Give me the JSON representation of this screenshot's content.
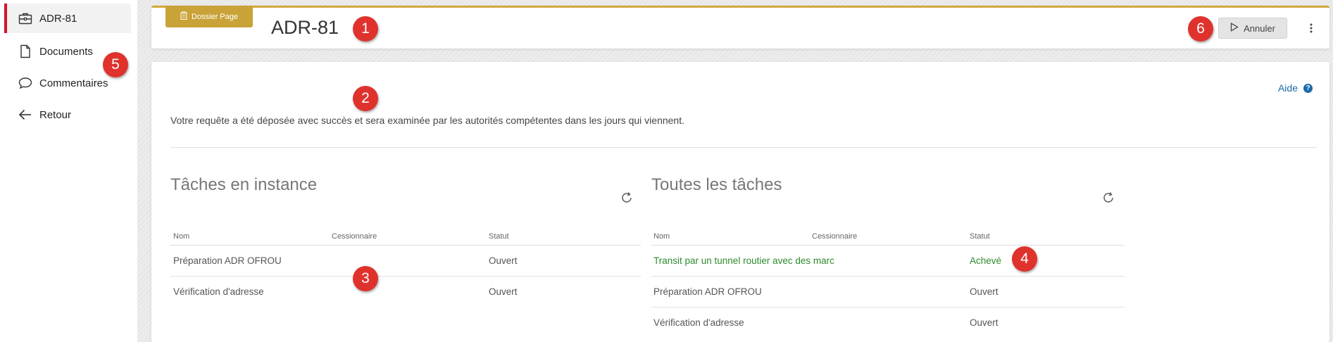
{
  "sidebar": {
    "items": [
      {
        "label": "ADR-81",
        "icon": "briefcase-icon"
      },
      {
        "label": "Documents",
        "icon": "document-icon"
      },
      {
        "label": "Commentaires",
        "icon": "comment-icon"
      },
      {
        "label": "Retour",
        "icon": "arrow-left-icon"
      }
    ]
  },
  "header": {
    "tab_label": "Dossier Page",
    "title": "ADR-81",
    "cancel_label": "Annuler"
  },
  "content": {
    "help_label": "Aide",
    "notice": "Votre requête a été déposée avec succès et sera examinée par les autorités compétentes dans les jours qui viennent."
  },
  "pending": {
    "title": "Tâches en instance",
    "columns": [
      "Nom",
      "Cessionnaire",
      "Statut"
    ],
    "rows": [
      {
        "name": "Préparation ADR OFROU",
        "assignee": "",
        "status": "Ouvert"
      },
      {
        "name": "Vérification d'adresse",
        "assignee": "",
        "status": "Ouvert"
      }
    ]
  },
  "all": {
    "title": "Toutes les tâches",
    "columns": [
      "Nom",
      "Cessionnaire",
      "Statut"
    ],
    "rows": [
      {
        "name": "Transit par un tunnel routier avec des marc",
        "assignee": "",
        "status": "Achevé"
      },
      {
        "name": "Préparation ADR OFROU",
        "assignee": "",
        "status": "Ouvert"
      },
      {
        "name": "Vérification d'adresse",
        "assignee": "",
        "status": "Ouvert"
      }
    ]
  },
  "callouts": [
    "1",
    "2",
    "3",
    "4",
    "5",
    "6"
  ],
  "colors": {
    "accent": "#d6112d",
    "gold": "#c9a338",
    "link": "#1a6aa8",
    "done": "#2e8b2e",
    "callout": "#e0322c"
  }
}
